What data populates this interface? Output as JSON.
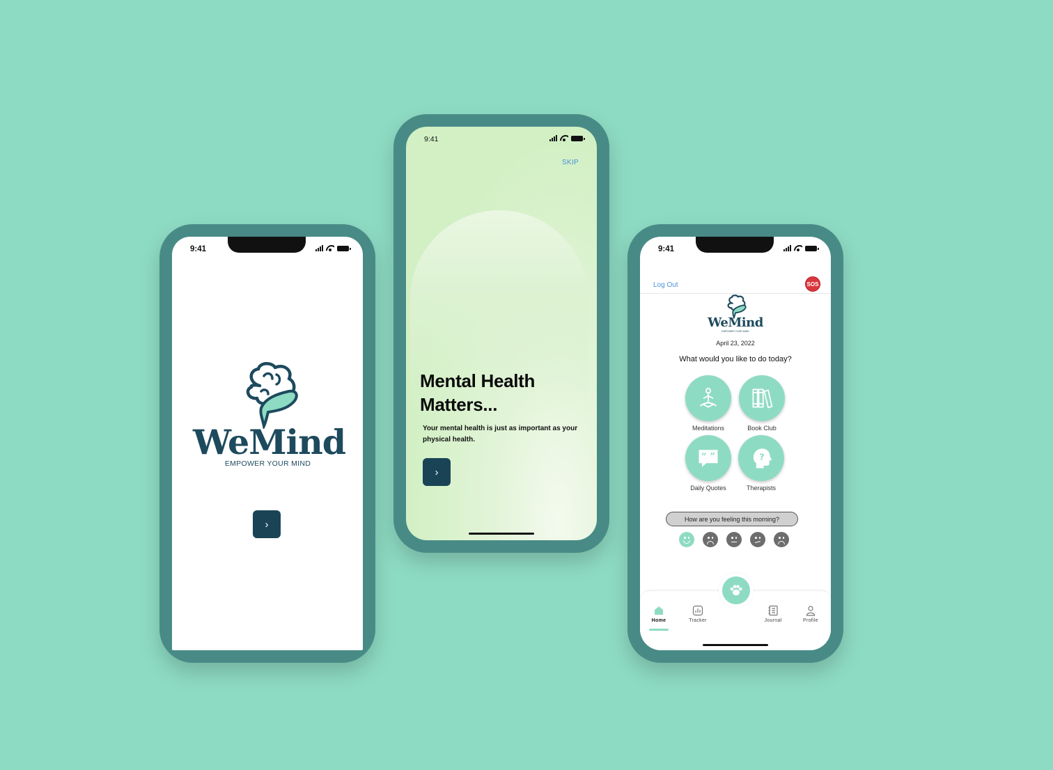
{
  "status": {
    "time": "9:41"
  },
  "splash": {
    "brand": "WeMind",
    "tagline": "EMPOWER YOUR MIND",
    "next_glyph": "›"
  },
  "onboarding": {
    "skip": "SKIP",
    "headline_line1": "Mental Health",
    "headline_line2": "Matters...",
    "body": "Your mental health is just as important as your physical health.",
    "next_glyph": "›"
  },
  "home": {
    "logout": "Log Out",
    "sos": "SOS",
    "brand": "WeMind",
    "tagline": "EMPOWER YOUR MIND",
    "date": "April 23, 2022",
    "question": "What would you like to do today?",
    "features": [
      {
        "label": "Meditations",
        "icon": "meditation-icon"
      },
      {
        "label": "Book Club",
        "icon": "books-icon"
      },
      {
        "label": "Daily Quotes",
        "icon": "quote-bubble-icon"
      },
      {
        "label": "Therapists",
        "icon": "head-question-icon"
      }
    ],
    "mood_prompt": "How are you feeling this morning?",
    "moods": [
      "happy",
      "sad",
      "neutral",
      "confused",
      "upset"
    ],
    "tabs": [
      {
        "label": "Home",
        "icon": "home-icon"
      },
      {
        "label": "Tracker",
        "icon": "chart-icon"
      },
      {
        "label": "Journal",
        "icon": "notebook-icon"
      },
      {
        "label": "Profile",
        "icon": "person-icon"
      }
    ]
  },
  "colors": {
    "background": "#8edbc3",
    "frame": "#488b86",
    "accent": "#8edbc3",
    "brand_dark": "#1d4a5d",
    "button": "#1a4456",
    "sos": "#d9363e",
    "link": "#4a90d9"
  }
}
